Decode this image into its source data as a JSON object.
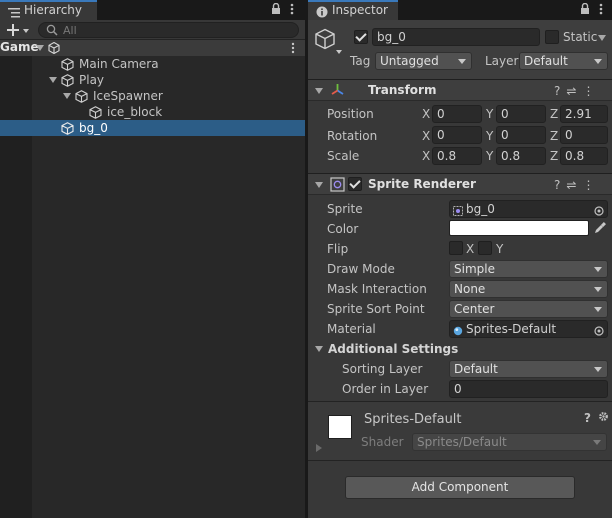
{
  "hierarchy": {
    "tab_label": "Hierarchy",
    "search_placeholder": "All",
    "scene_name": "Game",
    "items": [
      {
        "label": "Main Camera"
      },
      {
        "label": "Play"
      },
      {
        "label": "IceSpawner"
      },
      {
        "label": "ice_block"
      },
      {
        "label": "bg_0"
      }
    ]
  },
  "inspector": {
    "tab_label": "Inspector",
    "object": {
      "name": "bg_0",
      "static_label": "Static",
      "tag_label": "Tag",
      "tag_value": "Untagged",
      "layer_label": "Layer",
      "layer_value": "Default"
    },
    "transform": {
      "title": "Transform",
      "position_label": "Position",
      "rotation_label": "Rotation",
      "scale_label": "Scale",
      "x_label": "X",
      "y_label": "Y",
      "z_label": "Z",
      "position": {
        "x": "0",
        "y": "0",
        "z": "2.91"
      },
      "rotation": {
        "x": "0",
        "y": "0",
        "z": "0"
      },
      "scale": {
        "x": "0.8",
        "y": "0.8",
        "z": "0.8"
      }
    },
    "sprite_renderer": {
      "title": "Sprite Renderer",
      "sprite_label": "Sprite",
      "sprite_value": "bg_0",
      "color_label": "Color",
      "color_value": "#ffffff",
      "flip_label": "Flip",
      "flip_x": "X",
      "flip_y": "Y",
      "draw_mode_label": "Draw Mode",
      "draw_mode_value": "Simple",
      "mask_label": "Mask Interaction",
      "mask_value": "None",
      "sort_point_label": "Sprite Sort Point",
      "sort_point_value": "Center",
      "material_label": "Material",
      "material_value": "Sprites-Default",
      "additional_label": "Additional Settings",
      "sorting_layer_label": "Sorting Layer",
      "sorting_layer_value": "Default",
      "order_label": "Order in Layer",
      "order_value": "0"
    },
    "material": {
      "name": "Sprites-Default",
      "shader_label": "Shader",
      "shader_value": "Sprites/Default"
    },
    "add_component_label": "Add Component"
  },
  "colors": {
    "selection": "#2c5d87",
    "accent": "#3a79bb"
  }
}
